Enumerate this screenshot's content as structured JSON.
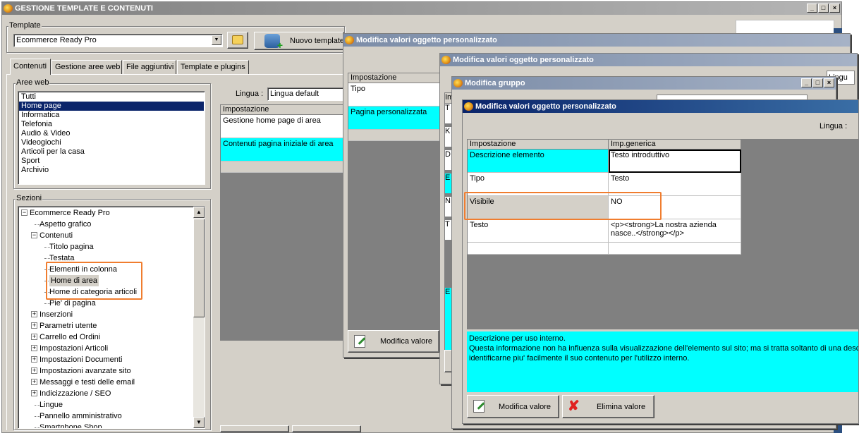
{
  "main_window": {
    "title": "GESTIONE TEMPLATE E CONTENUTI",
    "template_group_label": "Template",
    "template_value": "Ecommerce Ready Pro",
    "new_template_label": "Nuovo template",
    "tabs": [
      "Contenuti",
      "Gestione aree web",
      "File aggiuntivi",
      "Template e plugins"
    ],
    "aree_web_label": "Aree web",
    "aree_web": [
      "Tutti",
      "Home page",
      "Informatica",
      "Telefonia",
      "Audio & Video",
      "Videogiochi",
      "Articoli per la casa",
      "Sport",
      "Archivio"
    ],
    "sezioni_label": "Sezioni",
    "tree": [
      {
        "label": "Ecommerce Ready Pro",
        "level": 0,
        "expander": "minus"
      },
      {
        "label": "Aspetto grafico",
        "level": 1,
        "expander": "none"
      },
      {
        "label": "Contenuti",
        "level": 1,
        "expander": "minus"
      },
      {
        "label": "Titolo pagina",
        "level": 2,
        "expander": "none"
      },
      {
        "label": "Testata",
        "level": 2,
        "expander": "none"
      },
      {
        "label": "Elementi in colonna",
        "level": 2,
        "expander": "none"
      },
      {
        "label": "Home di area",
        "level": 2,
        "expander": "none",
        "selected": true
      },
      {
        "label": "Home di categoria articoli",
        "level": 2,
        "expander": "none"
      },
      {
        "label": "Pie' di pagina",
        "level": 2,
        "expander": "none"
      },
      {
        "label": "Inserzioni",
        "level": 1,
        "expander": "plus"
      },
      {
        "label": "Parametri utente",
        "level": 1,
        "expander": "plus"
      },
      {
        "label": "Carrello ed Ordini",
        "level": 1,
        "expander": "plus"
      },
      {
        "label": "Impostazioni Articoli",
        "level": 1,
        "expander": "plus"
      },
      {
        "label": "Impostazioni Documenti",
        "level": 1,
        "expander": "plus"
      },
      {
        "label": "Impostazioni avanzate sito",
        "level": 1,
        "expander": "plus"
      },
      {
        "label": "Messaggi e testi delle email",
        "level": 1,
        "expander": "plus"
      },
      {
        "label": "Indicizzazione / SEO",
        "level": 1,
        "expander": "plus"
      },
      {
        "label": "Lingue",
        "level": 1,
        "expander": "none"
      },
      {
        "label": "Pannello amministrativo",
        "level": 1,
        "expander": "none"
      },
      {
        "label": "Smartphone Shop",
        "level": 1,
        "expander": "none"
      }
    ],
    "lingua_label": "Lingua :",
    "lingua_value": "Lingua default",
    "grid_header": "Impostazione",
    "grid_rows": [
      "Gestione home page di area",
      "Contenuti pagina iniziale di area"
    ]
  },
  "dialog1": {
    "title": "Modifica valori oggetto personalizzato",
    "header": "Impostazione",
    "rows": [
      "Tipo",
      "Pagina personalizzata"
    ],
    "edit_button": "Modifica valore"
  },
  "dialog2": {
    "title": "Modifica valori oggetto personalizzato",
    "partial_lingua": "Lingu",
    "partial_header": "Im",
    "partial_letters": [
      "T",
      "K",
      "D",
      "E",
      "N",
      "T",
      "E"
    ]
  },
  "dialog3": {
    "title": "Modifica gruppo"
  },
  "dialog4": {
    "title": "Modifica valori oggetto personalizzato",
    "lingua_label": "Lingua :",
    "headers": [
      "Impostazione",
      "Imp.generica"
    ],
    "rows": [
      {
        "name": "Descrizione elemento",
        "value": "Testo introduttivo"
      },
      {
        "name": "Tipo",
        "value": "Testo"
      },
      {
        "name": "Visibile",
        "value": "NO"
      },
      {
        "name": "Testo",
        "value": "<p><strong>La nostra azienda nasce..</strong></p>"
      },
      {
        "name": "",
        "value": ""
      }
    ],
    "description_lines": [
      "Descrizione per uso interno.",
      "Questa informazione non ha influenza sulla visualizzazione dell'elemento sul sito; ma si tratta soltanto di una desc",
      "identificarne piu' facilmente il suo contenuto per l'utilizzo interno."
    ],
    "edit_button": "Modifica valore",
    "delete_button": "Elimina valore"
  },
  "colors": {
    "highlight": "#f07d2f",
    "cyan": "#00ffff",
    "selection": "#0a246a",
    "title_active": "#0a246a"
  }
}
